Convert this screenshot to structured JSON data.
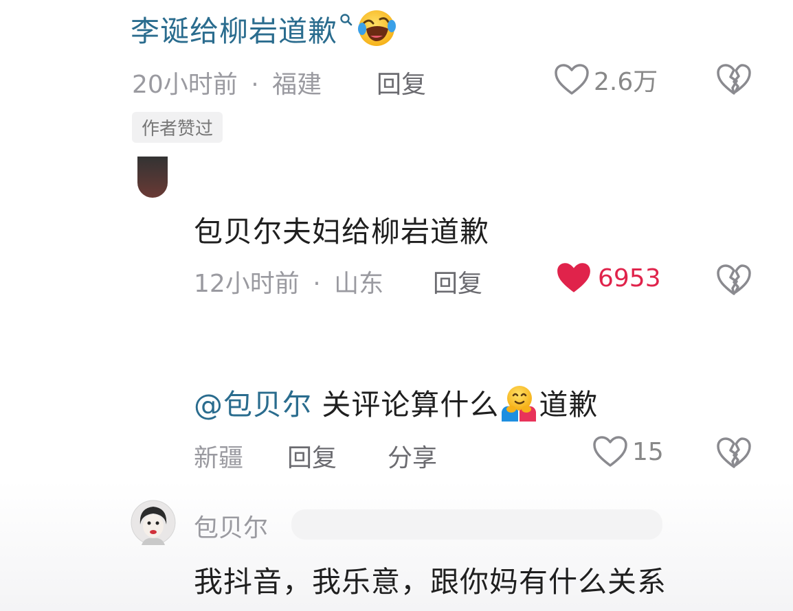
{
  "comment_top": {
    "text": "李诞给柳岩道歉",
    "time": "20小时前",
    "separator": "·",
    "location": "福建",
    "reply_label": "回复",
    "like_count": "2.6万",
    "badge": "作者赞过",
    "emoji": "rolling-laughing-face-icon"
  },
  "reply_1": {
    "text": "包贝尔夫妇给柳岩道歉",
    "time": "12小时前",
    "separator": "·",
    "location": "山东",
    "reply_label": "回复",
    "like_count": "6953",
    "liked_color": "#e0234b"
  },
  "reply_2": {
    "mention": "@包贝尔",
    "text_before_emoji": "关评论算什么",
    "text_after_emoji": "道歉",
    "emoji": "hugging-face-icon",
    "location": "新疆",
    "reply_label": "回复",
    "share_label": "分享",
    "like_count": "15"
  },
  "reply_3": {
    "username": "包贝尔",
    "text": "我抖音，我乐意，跟你妈有什么关系"
  },
  "colors": {
    "link_blue": "#2a6c8e",
    "meta_gray": "#9a9aa0",
    "liked_red": "#e0234b"
  }
}
